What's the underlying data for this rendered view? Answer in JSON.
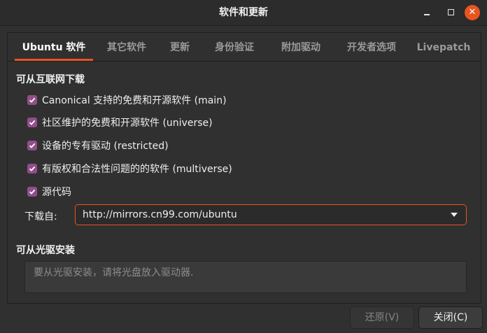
{
  "window": {
    "title": "软件和更新",
    "minimize_icon": "minimize-icon",
    "maximize_icon": "maximize-icon",
    "close_icon": "close-icon",
    "accent_color": "#e95420"
  },
  "tabs": [
    {
      "label": "Ubuntu 软件",
      "active": true
    },
    {
      "label": "其它软件",
      "active": false
    },
    {
      "label": "更新",
      "active": false
    },
    {
      "label": "身份验证",
      "active": false
    },
    {
      "label": "附加驱动",
      "active": false
    },
    {
      "label": "开发者选项",
      "active": false
    },
    {
      "label": "Livepatch",
      "active": false
    }
  ],
  "download_section": {
    "heading": "可从互联网下载",
    "checkbox_color": "#924d8b",
    "options": [
      {
        "label": "Canonical 支持的免费和开源软件 (main)",
        "checked": true
      },
      {
        "label": "社区维护的免费和开源软件 (universe)",
        "checked": true
      },
      {
        "label": "设备的专有驱动 (restricted)",
        "checked": true
      },
      {
        "label": "有版权和合法性问题的的软件 (multiverse)",
        "checked": true
      },
      {
        "label": "源代码",
        "checked": true
      }
    ],
    "download_from_label": "下载自:",
    "download_from_value": "http://mirrors.cn99.com/ubuntu"
  },
  "cdrom_section": {
    "heading": "可从光驱安装",
    "placeholder": "要从光驱安装，请将光盘放入驱动器."
  },
  "footer": {
    "revert_label": "还原(V)",
    "close_label": "关闭(C)"
  }
}
